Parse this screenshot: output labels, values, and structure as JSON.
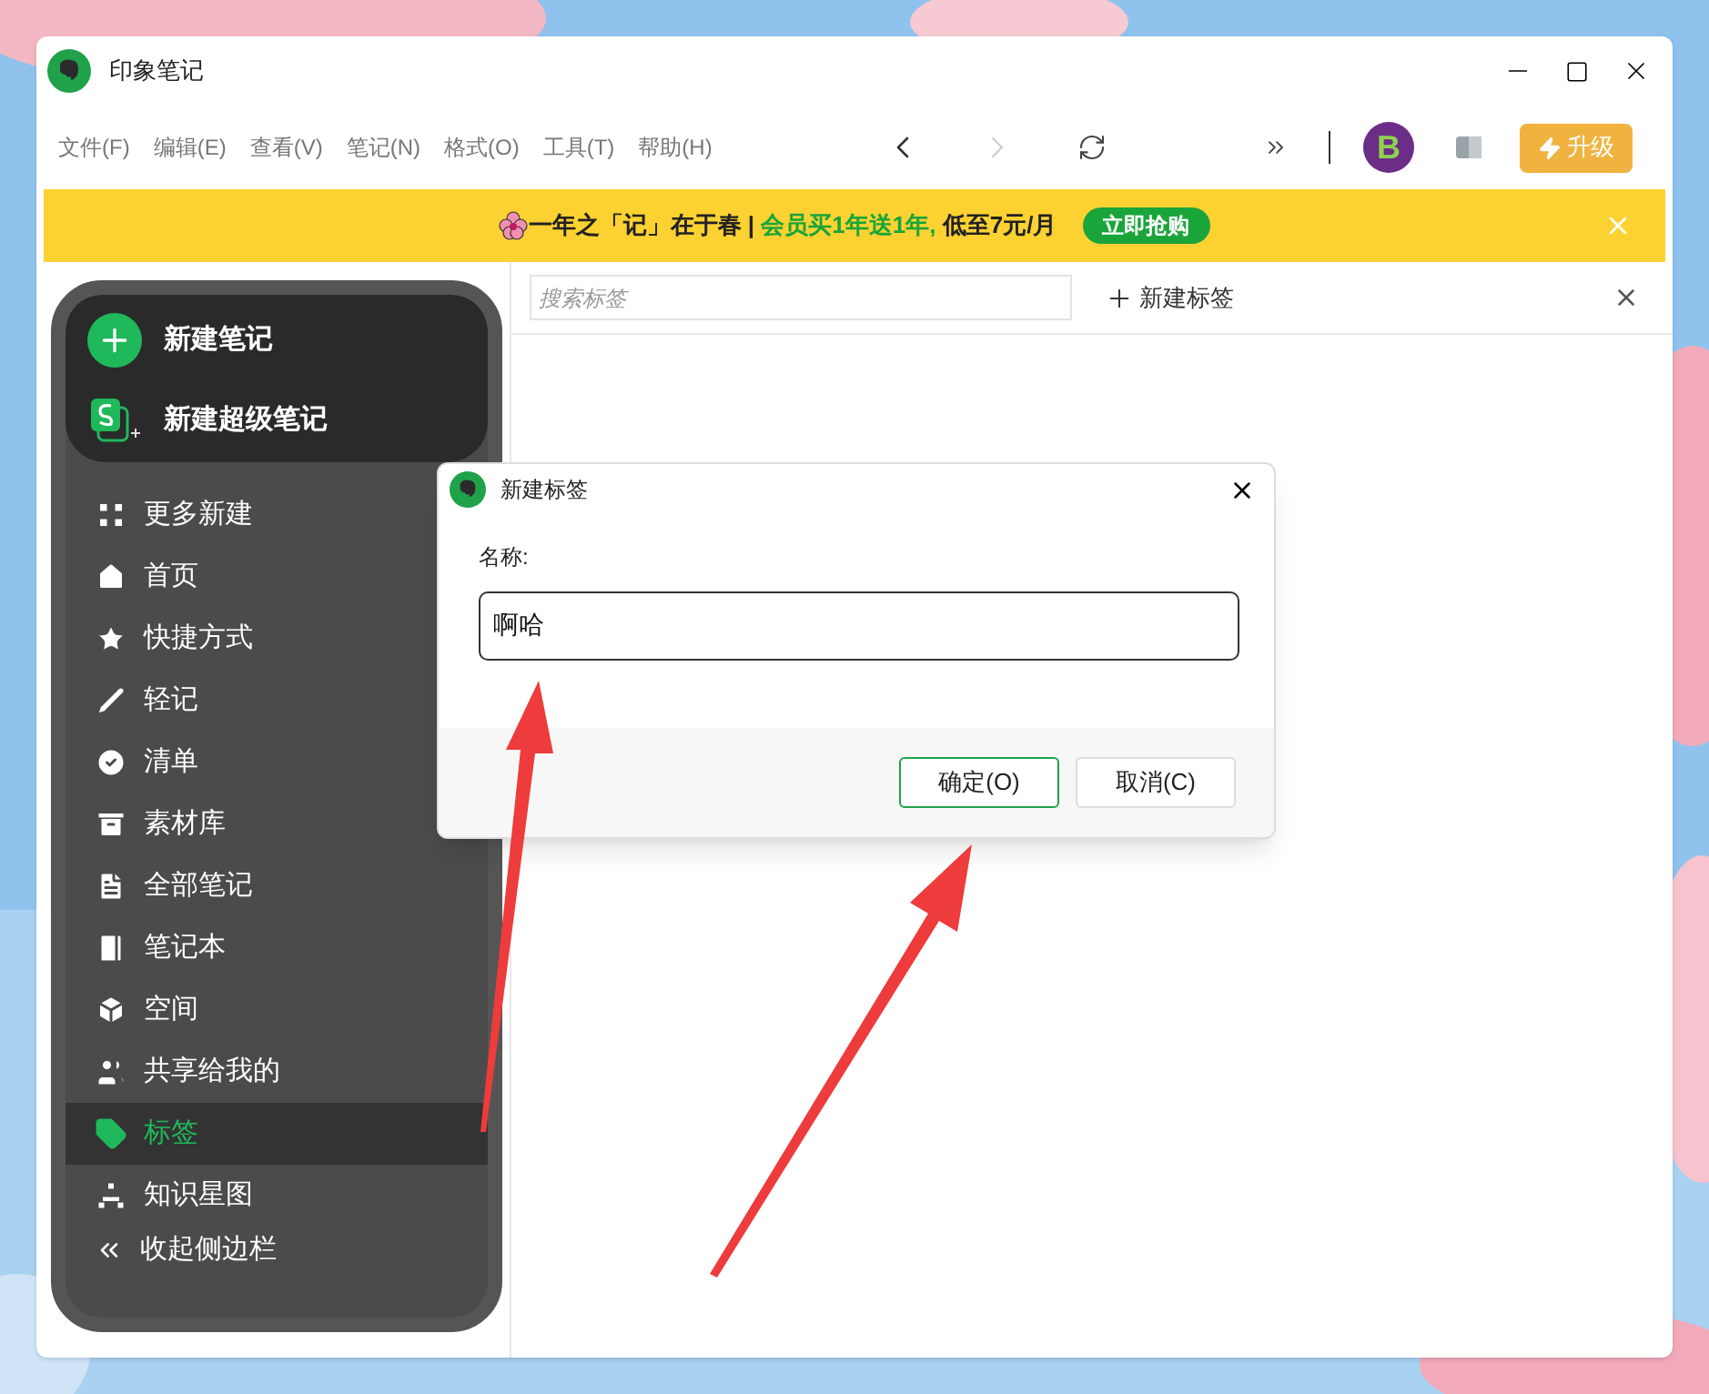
{
  "window": {
    "title": "印象笔记"
  },
  "menu": [
    "文件(F)",
    "编辑(E)",
    "查看(V)",
    "笔记(N)",
    "格式(O)",
    "工具(T)",
    "帮助(H)"
  ],
  "avatar": {
    "letter": "B"
  },
  "upgrade_button": "升级",
  "banner": {
    "lead": "一年之「记」在于春 | ",
    "highlight": "会员买1年送1年,",
    "tail": " 低至7元/月",
    "cta": "立即抢购"
  },
  "sidebar": {
    "new_note": "新建笔记",
    "new_super_note": "新建超级笔记",
    "items": [
      {
        "label": "更多新建",
        "selected": false
      },
      {
        "label": "首页",
        "selected": false
      },
      {
        "label": "快捷方式",
        "selected": false
      },
      {
        "label": "轻记",
        "selected": false
      },
      {
        "label": "清单",
        "selected": false
      },
      {
        "label": "素材库",
        "selected": false
      },
      {
        "label": "全部笔记",
        "selected": false
      },
      {
        "label": "笔记本",
        "selected": false
      },
      {
        "label": "空间",
        "selected": false
      },
      {
        "label": "共享给我的",
        "selected": false
      },
      {
        "label": "标签",
        "selected": true
      },
      {
        "label": "知识星图",
        "selected": false
      }
    ],
    "collapse": "收起侧边栏"
  },
  "tags_pane": {
    "search": {
      "placeholder": "搜索标签"
    },
    "new_tag": "新建标签"
  },
  "dialog": {
    "title": "新建标签",
    "field_label": "名称:",
    "value": "啊哈",
    "buttons": [
      {
        "label": "确定(O)",
        "primary": true
      },
      {
        "label": "取消(C)",
        "primary": false
      }
    ]
  }
}
